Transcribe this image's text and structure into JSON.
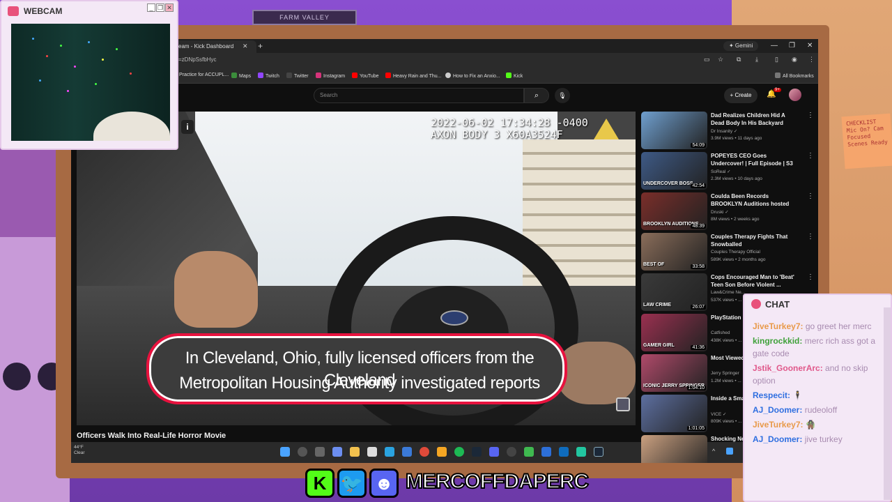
{
  "webcam": {
    "title": "WEBCAM",
    "win_min": "_",
    "win_max": "❐",
    "win_close": "✕"
  },
  "background": {
    "sign": "FARM VALLEY",
    "sticky_note": "CHECKLIST Mic On? Cam Focused Scenes Ready"
  },
  "browser": {
    "tab_title": "eam - Kick Dashboard",
    "tab_close": "✕",
    "tab_new": "+",
    "gemini": "✦ Gemini",
    "url": "=zDNpSsfbHyc",
    "bookmarks": [
      "Practice for ACCUPL...",
      "Maps",
      "Twitch",
      "Twitter",
      "Instagram",
      "YouTube",
      "Heavy Rain and Thu...",
      "How to Fix an Anxio...",
      "Kick"
    ],
    "all_bookmarks": "All Bookmarks",
    "win_min": "—",
    "win_max": "❐",
    "win_close": "✕"
  },
  "youtube": {
    "search_placeholder": "Search",
    "create_label": "Create",
    "notif_badge": "9+",
    "video": {
      "timestamp_line1": "2022-06-02 17:34:28 -0400",
      "timestamp_line2": "AXON BODY 3 X60A3524F",
      "caption_line1": "In Cleveland, Ohio, fully licensed officers from the Cleveland",
      "caption_line2": "Metropolitan Housing Authority investigated reports",
      "info": "i",
      "title": "Officers Walk Into Real-Life Horror Movie"
    },
    "recommendations": [
      {
        "title": "Dad Realizes Children Hid A Dead Body In His Backyard",
        "channel": "Dr Insanity ✓",
        "meta": "3.9M views • 11 days ago",
        "duration": "54:09",
        "thumb_text": "",
        "color": "#6f9fcf"
      },
      {
        "title": "POPEYES CEO Goes Undercover! | Full Episode | S3 ...",
        "channel": "SoReal ✓",
        "meta": "2.3M views • 10 days ago",
        "duration": "42:54",
        "thumb_text": "UNDERCOVER BOSS",
        "color": "#3e5a86"
      },
      {
        "title": "Coulda Been Records BROOKLYN Auditions hosted b...",
        "channel": "Druski ✓",
        "meta": "8M views • 2 weeks ago",
        "duration": "48:39",
        "thumb_text": "BROOKLYN AUDITIONS",
        "color": "#7a2e2a"
      },
      {
        "title": "Couples Therapy Fights That Snowballed",
        "channel": "Couples Therapy Official",
        "meta": "589K views • 2 months ago",
        "duration": "33:58",
        "thumb_text": "BEST OF",
        "color": "#8a6d5a"
      },
      {
        "title": "Cops Encouraged Man to 'Beat' Teen Son Before Violent ...",
        "channel": "Law&Crime Ne...",
        "meta": "537K views • ...",
        "duration": "26:07",
        "thumb_text": "LAW CRIME",
        "color": "#3a3a3a"
      },
      {
        "title": "PlayStation ... Leads to She...",
        "channel": "Catfished",
        "meta": "438K views • ...",
        "duration": "41:36",
        "thumb_text": "GAMER GIRL",
        "color": "#9a3050"
      },
      {
        "title": "Most Viewed ... Show Mome...",
        "channel": "Jerry Springer",
        "meta": "1.2M views • ...",
        "duration": "1:04:10",
        "thumb_text": "ICONIC JERRY SPRINGER",
        "color": "#b04a6a"
      },
      {
        "title": "Inside a Sma... The Manor (...",
        "channel": "VICE ✓",
        "meta": "809K views • ...",
        "duration": "1:01:05",
        "thumb_text": "",
        "color": "#5d6fa0"
      },
      {
        "title": "Shocking Ne...",
        "channel": "",
        "meta": "",
        "duration": "",
        "thumb_text": "",
        "color": "#caa080"
      }
    ]
  },
  "taskbar": {
    "weather_temp": "44°F",
    "weather_cond": "Clear"
  },
  "chat": {
    "title": "CHAT",
    "messages": [
      {
        "user": "JiveTurkey7:",
        "text": " go greet her merc",
        "color": "#e89a4a"
      },
      {
        "user": "kingrockkid:",
        "text": " merc rich ass got a gate code",
        "color": "#3fa13a"
      },
      {
        "user": "Jstik_GoonerArc:",
        "text": " and no skip option",
        "color": "#e0588a"
      },
      {
        "user": "Respecit:",
        "text": " 🕴",
        "color": "#2f6fe0"
      },
      {
        "user": "AJ_Doomer:",
        "text": " rudeoloff",
        "color": "#2f6fe0"
      },
      {
        "user": "JiveTurkey7:",
        "text": " 🧌",
        "color": "#e89a4a"
      },
      {
        "user": "AJ_Doomer:",
        "text": " jive turkey",
        "color": "#2f6fe0"
      }
    ]
  },
  "socials": {
    "kick": "K",
    "twitter": "🐦",
    "discord": "☻",
    "handle": "MERCOFFDAPERC"
  },
  "colors": {
    "accent": "#e8123e",
    "chat_bg": "#f4e8f6",
    "youtube_red": "#cc0000"
  }
}
